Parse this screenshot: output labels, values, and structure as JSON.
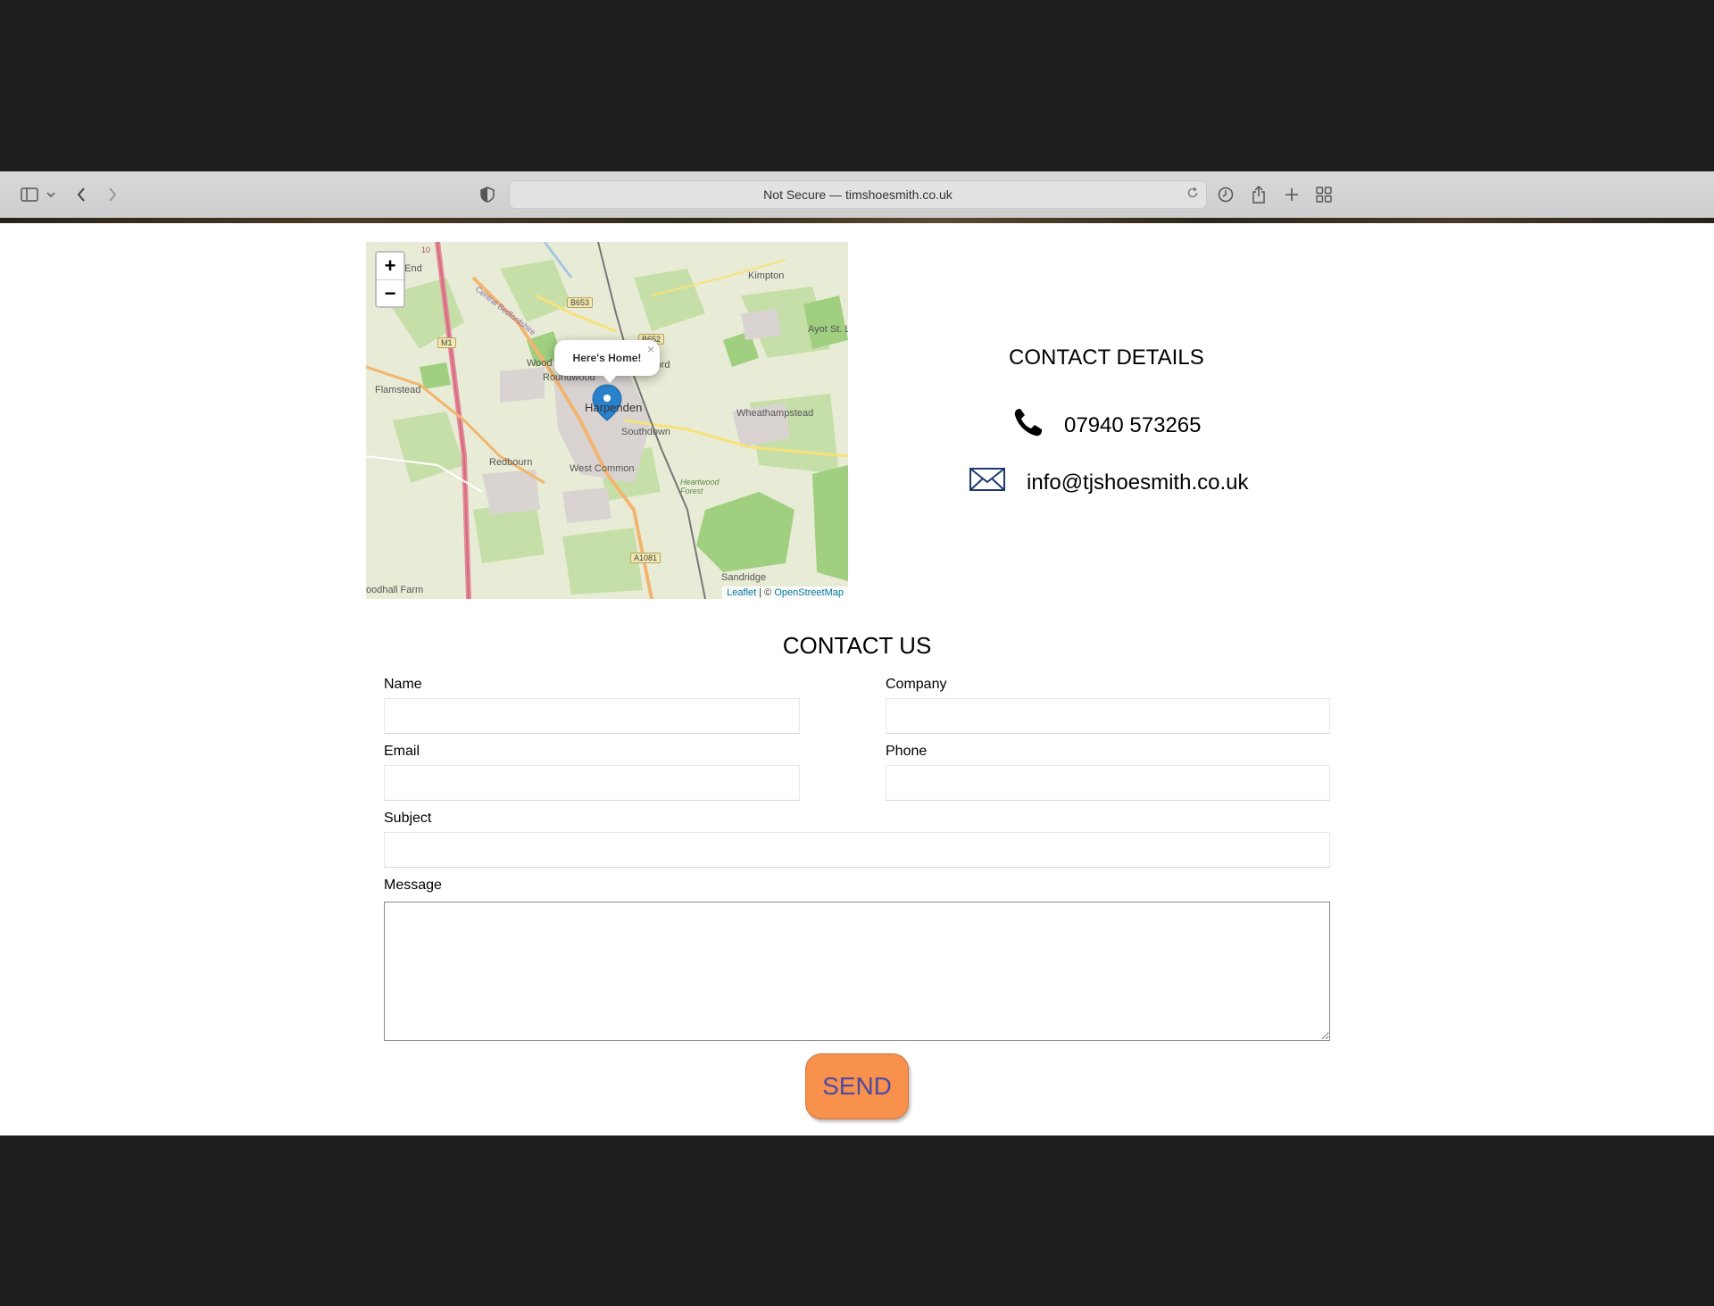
{
  "browser": {
    "url_text": "Not Secure — timshoesmith.co.uk"
  },
  "map": {
    "zoom_in": "+",
    "zoom_out": "−",
    "popup_text": "Here's Home!",
    "popup_close": "×",
    "attribution_leaflet": "Leaflet",
    "attribution_sep": " | © ",
    "attribution_osm": "OpenStreetMap",
    "places": {
      "kimpton": "Kimpton",
      "ayot": "Ayot St. L",
      "wood_end": "Wood End",
      "roundwood": "Roundwood",
      "batford": "Batford",
      "flamstead": "Flamstead",
      "harpenden": "Harpenden",
      "wheathampstead": "Wheathampstead",
      "southdown": "Southdown",
      "redbourn": "Redbourn",
      "west_common": "West Common",
      "heartwood": "Heartwood Forest",
      "sandridge": "Sandridge",
      "woodhall": "oodhall Farm",
      "p_end": "p End",
      "central_beds": "Central Bedfordshire",
      "b653": "B653",
      "b652": "B652",
      "m1": "M1",
      "a1081": "A1081",
      "r10": "10"
    }
  },
  "contact_details": {
    "title": "CONTACT DETAILS",
    "phone": "07940 573265",
    "email": "info@tjshoesmith.co.uk"
  },
  "contact_form": {
    "title": "CONTACT US",
    "name_label": "Name",
    "company_label": "Company",
    "email_label": "Email",
    "phone_label": "Phone",
    "subject_label": "Subject",
    "message_label": "Message",
    "name_value": "",
    "company_value": "",
    "email_value": "",
    "phone_value": "",
    "subject_value": "",
    "message_value": "",
    "send_label": "SEND"
  }
}
